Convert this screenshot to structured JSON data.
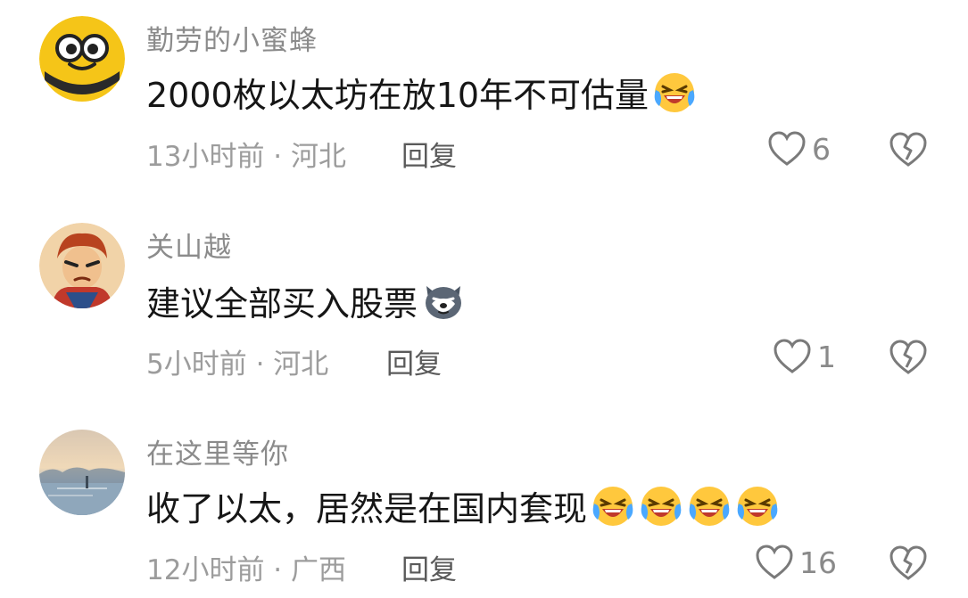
{
  "comments": [
    {
      "username": "勤劳的小蜜蜂",
      "text": "2000枚以太坊在放10年不可估量",
      "emojis": [
        "laughing-crying-emoji"
      ],
      "time": "13小时前",
      "location": "河北",
      "meta": "13小时前 · 河北",
      "reply": "回复",
      "likes": "6",
      "avatar": "bee-avatar"
    },
    {
      "username": "关山越",
      "text": "建议全部买入股票",
      "emojis": [
        "husky-emoji"
      ],
      "time": "5小时前",
      "location": "河北",
      "meta": "5小时前 · 河北",
      "reply": "回复",
      "likes": "1",
      "avatar": "cartoon-man-avatar"
    },
    {
      "username": "在这里等你",
      "text": "收了以太，居然是在国内套现",
      "emojis": [
        "laughing-crying-emoji",
        "laughing-crying-emoji",
        "laughing-crying-emoji",
        "laughing-crying-emoji"
      ],
      "time": "12小时前",
      "location": "广西",
      "meta": "12小时前 · 广西",
      "reply": "回复",
      "likes": "16",
      "avatar": "landscape-avatar"
    }
  ],
  "colors": {
    "username": "#8b8b8b",
    "text": "#161616",
    "meta": "#9c9c9c",
    "icon": "#7a7a7a"
  }
}
